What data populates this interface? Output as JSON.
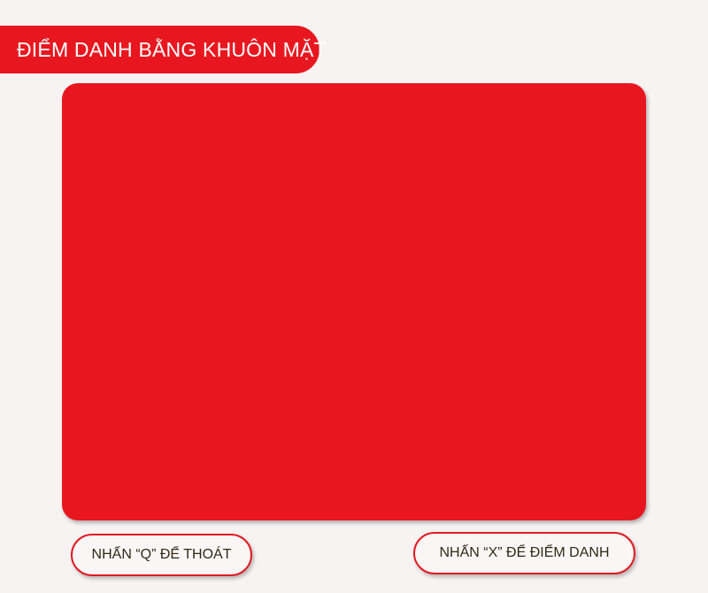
{
  "header": {
    "title": "ĐIỂM DANH BẰNG KHUÔN MẶT"
  },
  "camera": {
    "state": "blank"
  },
  "actions": {
    "quit_label": "NHẤN “Q” ĐỂ THOÁT",
    "checkin_label": "NHẤN “X” ĐỂ ĐIỂM DANH"
  },
  "colors": {
    "accent": "#e8171f",
    "background": "#f8f3f3",
    "button_text": "#2e2a14"
  }
}
